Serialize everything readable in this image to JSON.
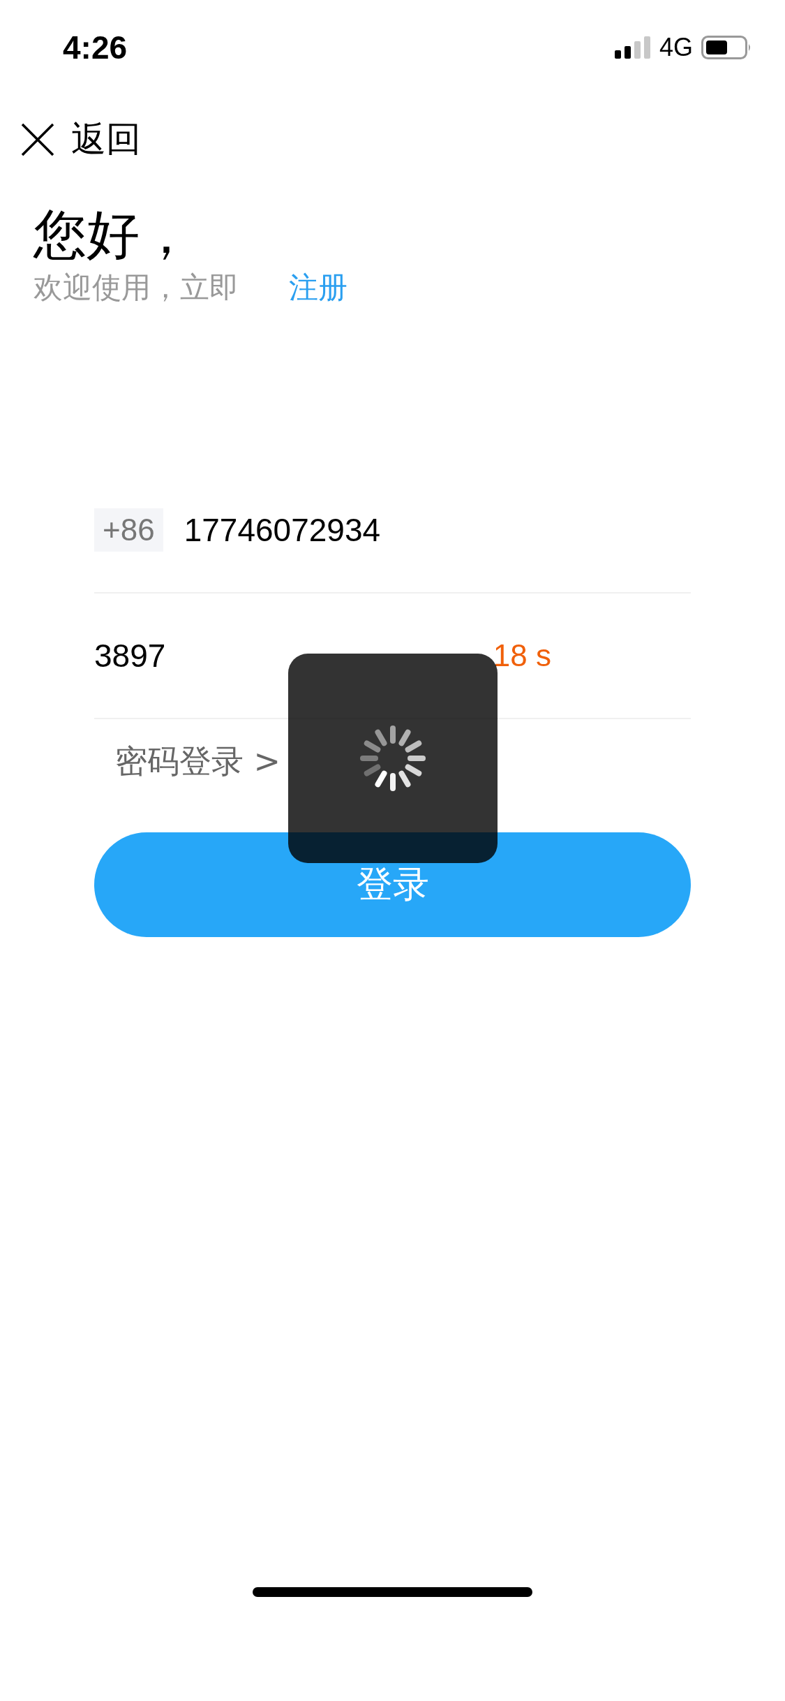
{
  "status_bar": {
    "time": "4:26",
    "network": "4G"
  },
  "nav": {
    "back_label": "返回"
  },
  "greeting": {
    "title": "您好，",
    "subtitle": "欢迎使用，立即",
    "register_link": "注册"
  },
  "form": {
    "country_code": "+86",
    "phone": "17746072934",
    "code": "3897",
    "countdown": "18 s",
    "password_login_link": "密码登录 >",
    "submit": "登录"
  },
  "loading": {
    "visible": true
  }
}
